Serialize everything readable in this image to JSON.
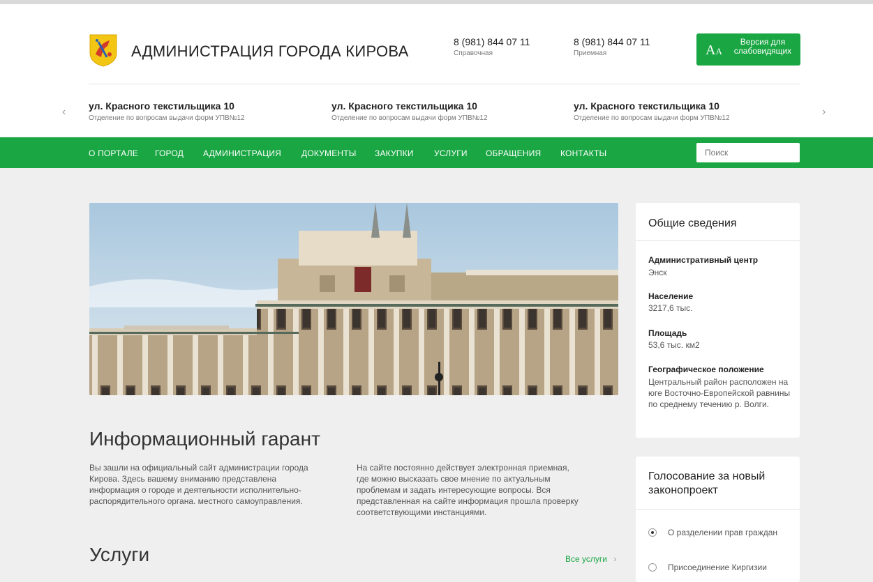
{
  "header": {
    "title": "АДМИНИСТРАЦИЯ ГОРОДА КИРОВА",
    "phones": [
      {
        "number": "8 (981) 844 07 11",
        "label": "Справочная"
      },
      {
        "number": "8 (981) 844 07 11",
        "label": "Приемная"
      }
    ],
    "accessible": {
      "icon_big": "A",
      "icon_small": "A",
      "label": "Версия для слабовидящих"
    },
    "logo_icon": "coat-of-arms-icon"
  },
  "carousel": {
    "prev_icon": "‹",
    "next_icon": "›",
    "items": [
      {
        "street": "ул. Красного текстильщика 10",
        "desc": "Отделение по вопросам выдачи форм УПВ№12"
      },
      {
        "street": "ул. Красного текстильщика 10",
        "desc": "Отделение по вопросам выдачи форм УПВ№12"
      },
      {
        "street": "ул. Красного текстильщика 10",
        "desc": "Отделение по вопросам выдачи форм УПВ№12"
      }
    ]
  },
  "nav": {
    "items": [
      "О ПОРТАЛЕ",
      "ГОРОД",
      "АДМИНИСТРАЦИЯ",
      "ДОКУМЕНТЫ",
      "ЗАКУПКИ",
      "УСЛУГИ",
      "ОБРАЩЕНИЯ",
      "КОНТАКТЫ"
    ],
    "search_placeholder": "Поиск"
  },
  "main": {
    "title": "Информационный гарант",
    "paragraphs": [
      "Вы зашли на официальный сайт администрации города Кирова. Здесь вашему вниманию представлена информация о городе и деятельности исполнительно-распорядительного органа. местного самоуправления.",
      "На сайте постоянно действует электронная приемная, где можно высказать свое мнение по актуальным проблемам и задать интересующие вопросы. Вся представленная на сайте информация прошла проверку соответствующими инстанциями."
    ],
    "services_title": "Услуги",
    "all_services": "Все услуги",
    "all_services_arrow": "›"
  },
  "info": {
    "title": "Общие сведения",
    "items": [
      {
        "label": "Административный центр",
        "value": "Энск"
      },
      {
        "label": "Население",
        "value": "3217,6 тыс."
      },
      {
        "label": "Площадь",
        "value": "53,6 тыс. км2"
      },
      {
        "label": "Географическое положение",
        "value": "Центральный район расположен на юге Восточно-Европейской равнины по среднему течению р. Волги."
      }
    ]
  },
  "vote": {
    "title": "Голосование за новый законопроект",
    "options": [
      {
        "label": "О разделении прав граждан",
        "checked": true
      },
      {
        "label": "Присоединение Киргизии",
        "checked": false
      }
    ]
  },
  "colors": {
    "accent": "#19a643",
    "background": "#efefef"
  }
}
